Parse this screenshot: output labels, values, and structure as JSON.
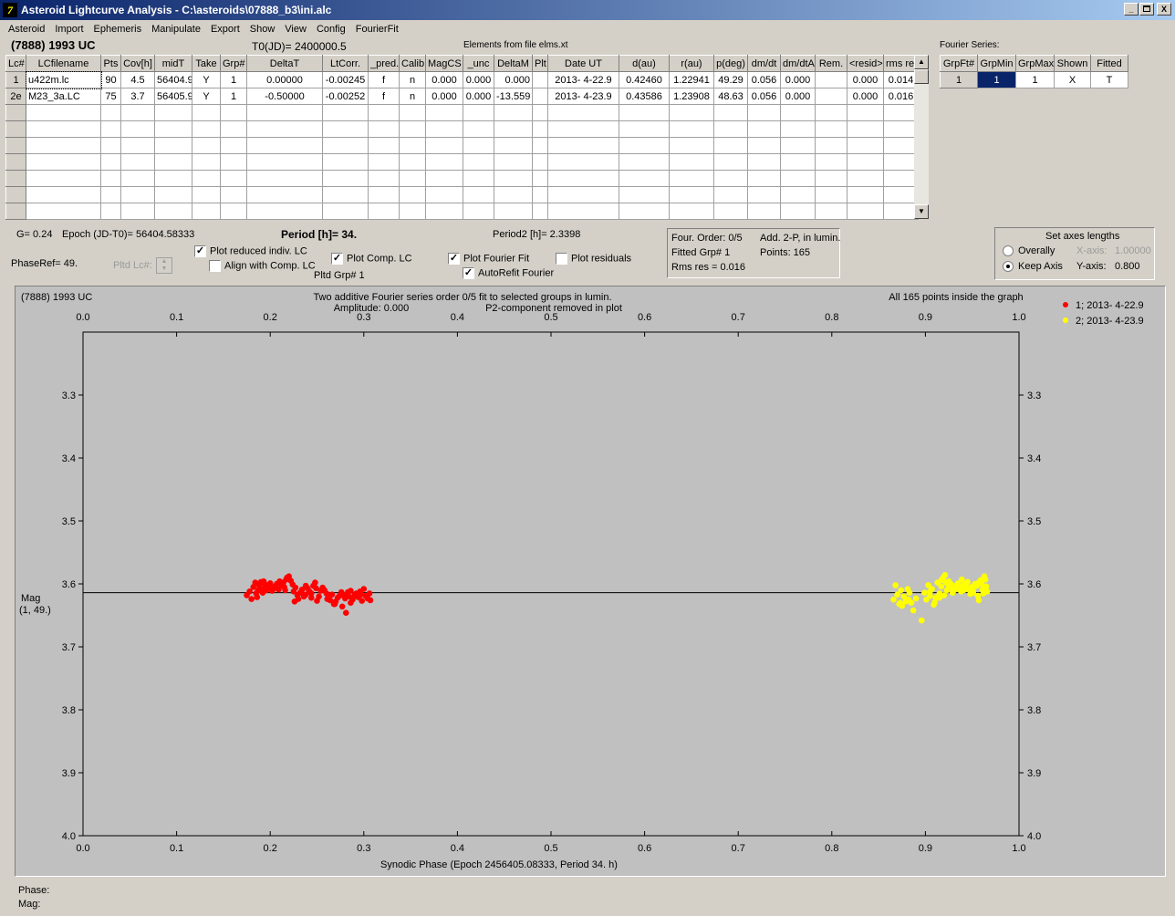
{
  "window": {
    "title": "Asteroid Lightcurve Analysis - C:\\asteroids\\07888_b3\\ini.alc",
    "icon": "7",
    "min": "_",
    "max": " ",
    "close": "X"
  },
  "menu": [
    "Asteroid",
    "Import",
    "Ephemeris",
    "Manipulate",
    "Export",
    "Show",
    "View",
    "Config",
    "FourierFit"
  ],
  "header": {
    "asteroid": "(7888) 1993 UC",
    "t0": "T0(JD)= 2400000.5",
    "elements": "Elements from file elms.xt"
  },
  "lc_table": {
    "columns": [
      "Lc#",
      "LCfilename",
      "Pts",
      "Cov[h]",
      "midT",
      "Take",
      "Grp#",
      "DeltaT",
      "LtCorr.",
      "_pred.",
      "Calib.",
      "MagCS",
      "_unc",
      "DeltaM",
      "Plt",
      "Date UT",
      "d(au)",
      "r(au)",
      "p(deg)",
      "dm/dt",
      "dm/dtA",
      "Rem.",
      "<resid>",
      "rms res"
    ],
    "rows": [
      [
        "1",
        "u422m.lc",
        "90",
        "4.5",
        "56404.9",
        "Y",
        "1",
        "0.00000",
        "-0.00245",
        "f",
        "n",
        "0.000",
        "0.000",
        "0.000",
        "",
        "2013- 4-22.9",
        "0.42460",
        "1.22941",
        "49.29",
        "0.056",
        "0.000",
        "",
        "0.000",
        "0.014"
      ],
      [
        "2e",
        "M23_3a.LC",
        "75",
        "3.7",
        "56405.9",
        "Y",
        "1",
        "-0.50000",
        "-0.00252",
        "f",
        "n",
        "0.000",
        "0.000",
        "-13.559",
        "",
        "2013- 4-23.9",
        "0.43586",
        "1.23908",
        "48.63",
        "0.056",
        "0.000",
        "",
        "0.000",
        "0.016"
      ]
    ],
    "empty_rows": 7
  },
  "fourier_table": {
    "title": "Fourier Series:",
    "columns": [
      "GrpFt#",
      "GrpMin",
      "GrpMax",
      "Shown",
      "Fitted"
    ],
    "row": [
      "1",
      "1",
      "1",
      "X",
      "T"
    ]
  },
  "params": {
    "g": "G= 0.24",
    "epoch": "Epoch (JD-T0)= 56404.58333",
    "period": "Period [h]= 34.",
    "period2": "Period2 [h]= 2.3398",
    "phaseref": "PhaseRef= 49.",
    "pltd_lc": "Pltd Lc#:",
    "pltd_grp": "Pltd Grp#  1"
  },
  "checks": [
    {
      "key": "reduced",
      "label": "Plot reduced indiv. LC",
      "checked": true
    },
    {
      "key": "align",
      "label": "Align with Comp. LC",
      "checked": false
    },
    {
      "key": "comp",
      "label": "Plot Comp. LC",
      "checked": true
    },
    {
      "key": "fourier",
      "label": "Plot Fourier Fit",
      "checked": true
    },
    {
      "key": "resid",
      "label": "Plot residuals",
      "checked": false
    },
    {
      "key": "autorefit",
      "label": "AutoRefit Fourier",
      "checked": true
    }
  ],
  "fit_info": {
    "order": "Four. Order:  0/5",
    "add": "Add. 2-P, in lumin.",
    "grp": "Fitted Grp# 1",
    "points": "Points: 165",
    "rms": "Rms res     = 0.016"
  },
  "axes_box": {
    "title": "Set axes lengths",
    "overall": "Overally",
    "keep": "Keep Axis",
    "xaxis_label": "X-axis:",
    "xaxis_val": "1.00000",
    "yaxis_label": "Y-axis:",
    "yaxis_val": "0.800",
    "selected": "keep"
  },
  "plot": {
    "name": "(7888) 1993 UC",
    "desc1": "Two additive Fourier series order 0/5 fit to selected groups in lumin.",
    "desc2a": "Amplitude: 0.000",
    "desc2b": "P2-component removed in plot",
    "inside": "All 165 points inside the graph",
    "xlabel": "Synodic Phase (Epoch 2456405.08333, Period 34. h)",
    "ylabel1": "Mag",
    "ylabel2": "(1, 49.)"
  },
  "chart_data": {
    "type": "scatter",
    "x_ticks": [
      "0.0",
      "0.1",
      "0.2",
      "0.3",
      "0.4",
      "0.5",
      "0.6",
      "0.7",
      "0.8",
      "0.9",
      "1.0"
    ],
    "y_ticks": [
      "3.3",
      "3.4",
      "3.5",
      "3.6",
      "3.7",
      "3.8",
      "3.9",
      "4.0"
    ],
    "xlim": [
      0,
      1
    ],
    "ylim": [
      3.2,
      4.0
    ],
    "y_inverted": true,
    "fit_line_mag": 3.614,
    "series": [
      {
        "name": "1; 2013- 4-22.9",
        "color": "#ff0000",
        "x": [
          0.175,
          0.178,
          0.18,
          0.182,
          0.184,
          0.185,
          0.186,
          0.188,
          0.19,
          0.191,
          0.192,
          0.194,
          0.195,
          0.196,
          0.198,
          0.2,
          0.202,
          0.204,
          0.205,
          0.207,
          0.209,
          0.21,
          0.212,
          0.214,
          0.215,
          0.217,
          0.218,
          0.22,
          0.222,
          0.224,
          0.225,
          0.227,
          0.229,
          0.23,
          0.232,
          0.234,
          0.236,
          0.238,
          0.24,
          0.242,
          0.244,
          0.246,
          0.248,
          0.25,
          0.252,
          0.254,
          0.256,
          0.258,
          0.26,
          0.262,
          0.264,
          0.266,
          0.268,
          0.27,
          0.272,
          0.274,
          0.276,
          0.278,
          0.28,
          0.282,
          0.284,
          0.286,
          0.288,
          0.29,
          0.292,
          0.294,
          0.296,
          0.298,
          0.3,
          0.302,
          0.304,
          0.306,
          0.307,
          0.277,
          0.281,
          0.286,
          0.269,
          0.244,
          0.238,
          0.226,
          0.211,
          0.199,
          0.193,
          0.187,
          0.283,
          0.297,
          0.261,
          0.249,
          0.233,
          0.216
        ],
        "y": [
          3.618,
          3.612,
          3.624,
          3.605,
          3.598,
          3.615,
          3.621,
          3.602,
          3.597,
          3.608,
          3.614,
          3.6,
          3.606,
          3.61,
          3.603,
          3.599,
          3.611,
          3.607,
          3.604,
          3.6,
          3.609,
          3.596,
          3.602,
          3.598,
          3.605,
          3.593,
          3.59,
          3.588,
          3.595,
          3.601,
          3.612,
          3.606,
          3.618,
          3.624,
          3.614,
          3.609,
          3.62,
          3.603,
          3.607,
          3.612,
          3.615,
          3.603,
          3.598,
          3.627,
          3.62,
          3.611,
          3.606,
          3.61,
          3.615,
          3.62,
          3.626,
          3.617,
          3.632,
          3.628,
          3.622,
          3.619,
          3.613,
          3.618,
          3.623,
          3.616,
          3.62,
          3.611,
          3.625,
          3.618,
          3.615,
          3.621,
          3.612,
          3.627,
          3.608,
          3.619,
          3.623,
          3.615,
          3.626,
          3.636,
          3.646,
          3.63,
          3.632,
          3.622,
          3.617,
          3.628,
          3.6,
          3.606,
          3.596,
          3.61,
          3.613,
          3.617,
          3.624,
          3.607,
          3.613,
          3.61
        ]
      },
      {
        "name": "2; 2013- 4-23.9",
        "color": "#ffff00",
        "x": [
          0.866,
          0.868,
          0.87,
          0.872,
          0.874,
          0.875,
          0.877,
          0.879,
          0.881,
          0.883,
          0.885,
          0.887,
          0.89,
          0.899,
          0.901,
          0.903,
          0.905,
          0.907,
          0.909,
          0.911,
          0.913,
          0.915,
          0.917,
          0.919,
          0.921,
          0.923,
          0.925,
          0.927,
          0.929,
          0.931,
          0.933,
          0.935,
          0.937,
          0.939,
          0.941,
          0.943,
          0.945,
          0.947,
          0.949,
          0.951,
          0.953,
          0.955,
          0.957,
          0.959,
          0.961,
          0.963,
          0.965,
          0.966,
          0.915,
          0.92,
          0.925,
          0.93,
          0.935,
          0.941,
          0.946,
          0.951,
          0.956,
          0.962,
          0.882,
          0.873,
          0.905,
          0.95,
          0.96,
          0.938,
          0.917,
          0.927,
          0.944,
          0.957,
          0.912,
          0.896,
          0.964,
          0.948,
          0.934,
          0.922,
          0.91
        ],
        "y": [
          3.625,
          3.602,
          3.617,
          3.632,
          3.61,
          3.635,
          3.62,
          3.628,
          3.608,
          3.614,
          3.63,
          3.642,
          3.623,
          3.614,
          3.625,
          3.602,
          3.619,
          3.608,
          3.633,
          3.622,
          3.598,
          3.615,
          3.604,
          3.59,
          3.586,
          3.61,
          3.596,
          3.605,
          3.614,
          3.609,
          3.602,
          3.604,
          3.608,
          3.593,
          3.61,
          3.6,
          3.597,
          3.607,
          3.605,
          3.611,
          3.6,
          3.603,
          3.598,
          3.594,
          3.609,
          3.588,
          3.604,
          3.612,
          3.622,
          3.618,
          3.603,
          3.611,
          3.599,
          3.602,
          3.607,
          3.614,
          3.619,
          3.615,
          3.625,
          3.63,
          3.612,
          3.606,
          3.6,
          3.612,
          3.594,
          3.6,
          3.608,
          3.626,
          3.621,
          3.658,
          3.593,
          3.616,
          3.607,
          3.598,
          3.629
        ]
      }
    ]
  },
  "status": {
    "phase": "Phase:",
    "mag": "Mag:"
  }
}
